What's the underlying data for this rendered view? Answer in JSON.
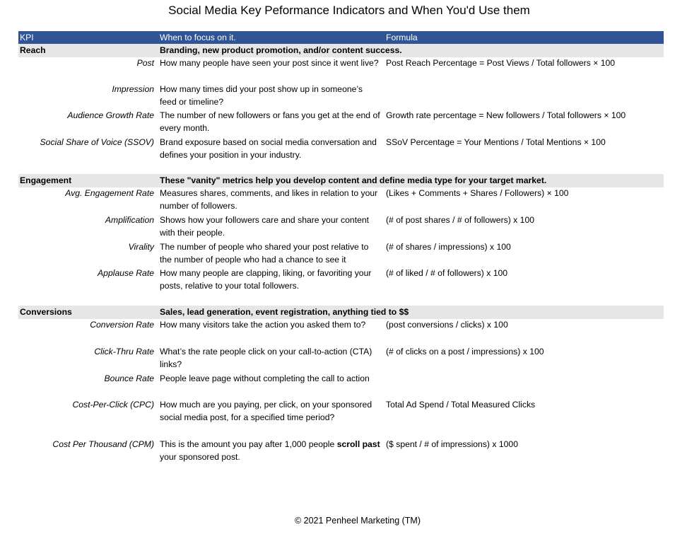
{
  "title": "Social Media Key Peformance Indicators and When You'd Use them",
  "header": {
    "kpi": "KPI",
    "when": "When to focus on it.",
    "formula": "Formula"
  },
  "colors": {
    "header_bg": "#305496",
    "header_text": "#ffffff",
    "section_bg": "#e7e6e6"
  },
  "sections": [
    {
      "name": "Reach",
      "description": "Branding, new product promotion, and/or content success.",
      "items": [
        {
          "kpi": "Post",
          "when": "How many people have seen your post since it went live?",
          "formula": "Post Reach Percentage = Post Views / Total followers × 100"
        },
        {
          "kpi": "Impression",
          "when": "How many times did your post show up in someone’s feed or timeline?",
          "formula": ""
        },
        {
          "kpi": "Audience Growth Rate",
          "when": "The number of new followers or fans you get at the end of every month.",
          "formula": "Growth rate percentage = New followers / Total followers × 100"
        },
        {
          "kpi": "Social Share of Voice (SSOV)",
          "when": "Brand exposure based on social media conversation and defines your position in your industry.",
          "formula": "SSoV Percentage = Your Mentions / Total Mentions × 100"
        }
      ]
    },
    {
      "name": "Engagement",
      "description": "These \"vanity\" metrics help you develop content and define media type for your target market.",
      "items": [
        {
          "kpi": "Avg. Engagement Rate",
          "when": "Measures shares, comments, and likes in relation to your number of followers.",
          "formula": "(Likes + Comments + Shares / Followers) × 100"
        },
        {
          "kpi": "Amplification",
          "when": "Shows how your followers care and share your content with their people.",
          "formula": "(# of post shares / # of followers) x 100"
        },
        {
          "kpi": "Virality",
          "when": "The number of people who shared your post relative to the number of people who had a chance to see it",
          "formula": "(# of shares / impressions) x 100"
        },
        {
          "kpi": "Applause Rate",
          "when": "How many people are clapping, liking, or favoriting your posts, relative to your total followers.",
          "formula": "(# of liked / # of followers) x 100"
        }
      ]
    },
    {
      "name": "Conversions",
      "description": "Sales, lead generation, event registration, anything tied to $$",
      "items": [
        {
          "kpi": "Conversion Rate",
          "when": "How many visitors take the action you asked them to?",
          "formula": "(post conversions / clicks) x 100"
        },
        {
          "kpi": "Click-Thru Rate",
          "when": "What’s the rate people click on your call-to-action (CTA) links?",
          "formula": "(# of clicks on a post / impressions) x 100"
        },
        {
          "kpi": "Bounce Rate",
          "when": "People leave page without completing the call to action",
          "formula": ""
        },
        {
          "kpi": "Cost-Per-Click (CPC)",
          "when": "How much are you paying, per click, on your sponsored social media post, for a specified time period?",
          "formula": "Total Ad Spend / Total Measured Clicks"
        },
        {
          "kpi": "Cost Per Thousand (CPM)",
          "when_parts": [
            "This is the amount you pay after 1,000 people ",
            "scroll past",
            " your sponsored post."
          ],
          "formula": "($ spent / # of impressions) x 1000"
        }
      ]
    }
  ],
  "footer": "© 2021 Penheel Marketing (TM)"
}
